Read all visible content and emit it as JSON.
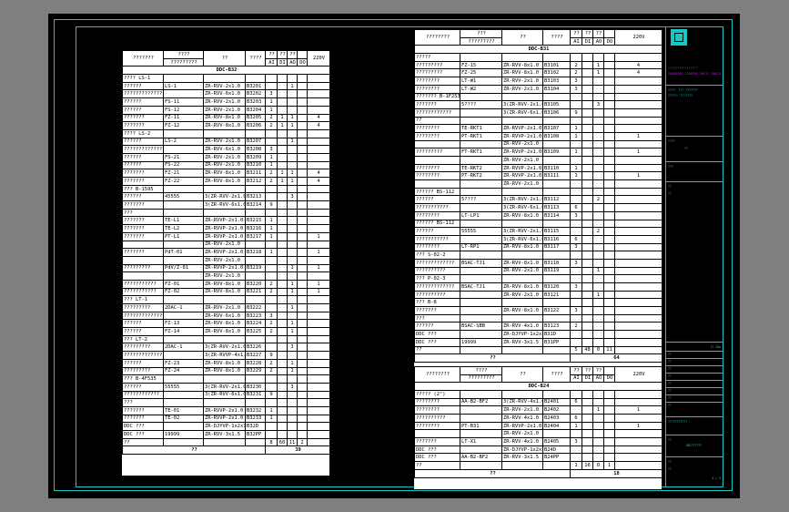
{
  "left_table": {
    "header": {
      "col1": "???????",
      "col2": "????",
      "col2b": "?????????",
      "col3": "??",
      "col4": "????",
      "m1": "??",
      "m2": "??",
      "m3": "??",
      "ai": "AI",
      "di": "DI",
      "ao": "AO",
      "do": "DO",
      "v24": "24V",
      "v220": "220V"
    },
    "title": "DDC-B32",
    "rows": [
      [
        "???? LS-1",
        "",
        "",
        "",
        "",
        "",
        "",
        "",
        ""
      ],
      [
        "??????",
        "LS-1",
        "ZR-RVV-2x1.0",
        "B3201",
        "",
        "",
        "1",
        "",
        ""
      ],
      [
        "?????????????",
        "",
        "ZR-RVV-6x1.0",
        "B3202",
        "3",
        "",
        "",
        "",
        ""
      ],
      [
        "??????",
        "FS-11",
        "ZR-RVV-2x1.0",
        "B3203",
        "1",
        "",
        "",
        "",
        ""
      ],
      [
        "??????",
        "FS-12",
        "ZR-RVV-2x1.0",
        "B3204",
        "1",
        "",
        "",
        "",
        ""
      ],
      [
        "???????",
        "FZ-11",
        "ZR-RVV-8x1.0",
        "B3205",
        "2",
        "1",
        "1",
        "",
        "4"
      ],
      [
        "???????",
        "FZ-12",
        "ZR-RVV-8x1.0",
        "B3206",
        "2",
        "1",
        "1",
        "",
        "4"
      ],
      [
        "???? LS-2",
        "",
        "",
        "",
        "",
        "",
        "",
        "",
        ""
      ],
      [
        "??????",
        "LS-2",
        "ZR-RVV-2x1.0",
        "B3207",
        "",
        "",
        "1",
        "",
        ""
      ],
      [
        "?????????????",
        "",
        "ZR-RVV-6x1.0",
        "B3208",
        "3",
        "",
        "",
        "",
        ""
      ],
      [
        "??????",
        "FS-21",
        "ZR-RVV-2x1.0",
        "B3209",
        "1",
        "",
        "",
        "",
        ""
      ],
      [
        "??????",
        "FS-22",
        "ZR-RVV-2x1.0",
        "B3210",
        "1",
        "",
        "",
        "",
        ""
      ],
      [
        "???????",
        "FZ-21",
        "ZR-RVV-8x1.0",
        "B3211",
        "2",
        "1",
        "1",
        "",
        "4"
      ],
      [
        "???????",
        "FZ-22",
        "ZR-RVV-8x1.0",
        "B3212",
        "2",
        "1",
        "1",
        "",
        "4"
      ],
      [
        "??? B-1595",
        "",
        "",
        "",
        "",
        "",
        "",
        "",
        ""
      ],
      [
        "??????",
        "45555",
        "3(ZR-RVV-2x1.0)",
        "B3213",
        "",
        "",
        "3",
        "",
        ""
      ],
      [
        "???????",
        "",
        "3(ZR-RVV-6x1.0)",
        "B3214",
        "9",
        "",
        "",
        "",
        ""
      ],
      [
        "???",
        "",
        "",
        "",
        "",
        "",
        "",
        "",
        ""
      ],
      [
        "???????",
        "TE-L1",
        "ZR-RVVP-2x1.0",
        "B3215",
        "1",
        "",
        "",
        "",
        ""
      ],
      [
        "???????",
        "TE-L2",
        "ZR-RVVP-2x1.0",
        "B3216",
        "1",
        "",
        "",
        "",
        ""
      ],
      [
        "???????",
        "PT-L1",
        "ZR-RVVP-2x1.0",
        "B3217",
        "1",
        "",
        "",
        "",
        "1"
      ],
      [
        "",
        "",
        "ZR-RVV-2x1.0",
        "",
        "",
        "",
        "",
        "",
        ""
      ],
      [
        "???????",
        "PdT-01",
        "ZR-RVVP-2x1.0",
        "B3218",
        "1",
        "",
        "",
        "",
        "1"
      ],
      [
        "",
        "",
        "ZR-RVV-2x1.0",
        "",
        "",
        "",
        "",
        "",
        ""
      ],
      [
        "?????????",
        "PdV/Z-01",
        "ZR-RVVP-2x1.0",
        "B3219",
        "",
        "",
        "1",
        "",
        "1"
      ],
      [
        "",
        "",
        "ZR-RVV-2x1.0",
        "",
        "",
        "",
        "",
        "",
        ""
      ],
      [
        "???????????",
        "FZ-01",
        "ZR-RVV-8x1.0",
        "B3220",
        "2",
        "",
        "1",
        "",
        "1"
      ],
      [
        "???????????",
        "FZ-02",
        "ZR-RVV-8x1.0",
        "B3221",
        "2",
        "",
        "1",
        "",
        "1"
      ],
      [
        "??? LT-1",
        "",
        "",
        "",
        "",
        "",
        "",
        "",
        ""
      ],
      [
        "?????????",
        "2DAC-1",
        "ZR-RVV-2x1.0",
        "B3222",
        "",
        "",
        "1",
        "",
        ""
      ],
      [
        "????????????????",
        "",
        "ZR-RVV-6x1.0",
        "B3223",
        "3",
        "",
        "",
        "",
        ""
      ],
      [
        "??????",
        "FZ-13",
        "ZR-RVV-8x1.0",
        "B3224",
        "2",
        "",
        "1",
        "",
        ""
      ],
      [
        "??????",
        "FZ-14",
        "ZR-RVV-8x1.0",
        "B3225",
        "2",
        "",
        "1",
        "",
        ""
      ],
      [
        "??? LT-2",
        "",
        "",
        "",
        "",
        "",
        "",
        "",
        ""
      ],
      [
        "?????????",
        "2DAC-1",
        "3(ZR-RVV-2x1.0)",
        "B3226",
        "",
        "",
        "3",
        "",
        ""
      ],
      [
        "????????????????",
        "",
        "3(ZR-RVVP-4x1.0)",
        "B3227",
        "9",
        "",
        "",
        "",
        ""
      ],
      [
        "??????",
        "FZ-23",
        "ZR-RVV-8x1.0",
        "B3228",
        "2",
        "",
        "1",
        "",
        ""
      ],
      [
        "?????????",
        "FZ-24",
        "ZR-RVV-8x1.0",
        "B3229",
        "2",
        "",
        "1",
        "",
        ""
      ],
      [
        "??? B-4F535",
        "",
        "",
        "",
        "",
        "",
        "",
        "",
        ""
      ],
      [
        "??????",
        "55555",
        "3(ZR-RVV-2x1.0)",
        "B3230",
        "",
        "",
        "3",
        "",
        ""
      ],
      [
        "????????????",
        "",
        "3(ZR-RVV-6x1.0)",
        "B3231",
        "9",
        "",
        "",
        "",
        ""
      ],
      [
        "???",
        "",
        "",
        "",
        "",
        "",
        "",
        "",
        ""
      ],
      [
        "???????",
        "TE-01",
        "ZR-RVVP-2x1.0",
        "B3232",
        "1",
        "",
        "",
        "",
        ""
      ],
      [
        "???????",
        "TE-02",
        "ZR-RVVP-2x1.0",
        "B3233",
        "1",
        "",
        "",
        "",
        ""
      ],
      [
        "DDC ???",
        "",
        "ZR-DJYVP-1x2x1.0",
        "B32D",
        "",
        "",
        "",
        "",
        ""
      ],
      [
        "DDC ???",
        "19999",
        "ZR-RVV-3x1.5",
        "B32PP",
        "",
        "",
        "",
        "",
        ""
      ],
      [
        "??",
        "",
        "",
        "",
        "8",
        "60",
        "11",
        "2",
        ""
      ]
    ],
    "total_label": "??",
    "total_value": "39"
  },
  "right_table_top": {
    "header": {
      "col1": "????????",
      "col2": "???",
      "col2b": "?????????",
      "col3": "??",
      "col4": "????",
      "m1": "??",
      "m2": "??",
      "m3": "??",
      "ai": "AI",
      "di": "DI",
      "ao": "AO",
      "do": "DO",
      "v24": "24V",
      "v220": "220V"
    },
    "title": "DDC-B31",
    "rows": [
      [
        "?????",
        "",
        "",
        "",
        "",
        "",
        "",
        "",
        ""
      ],
      [
        "?????????",
        "FZ-15",
        "ZR-RVV-8x1.0",
        "B3101",
        "2",
        "",
        "1",
        "",
        "4"
      ],
      [
        "?????????",
        "FZ-25",
        "ZR-RVV-8x1.0",
        "B3102",
        "2",
        "",
        "1",
        "",
        "4"
      ],
      [
        "????????",
        "LT-W1",
        "ZR-RVV-2x1.0",
        "B3103",
        "3",
        "",
        "",
        "",
        ""
      ],
      [
        "????????",
        "LT-W2",
        "ZR-RVV-2x1.0",
        "B3104",
        "3",
        "",
        "",
        "",
        ""
      ],
      [
        "??????? B-1F253",
        "",
        "",
        "",
        "",
        "",
        "",
        "",
        ""
      ],
      [
        "???????",
        "5????",
        "3(ZR-RVV-2x1.0)",
        "B3105",
        "",
        "",
        "3",
        "",
        ""
      ],
      [
        "????????????",
        "",
        "3(ZR-RVV-6x1.0)",
        "B3106",
        "9",
        "",
        "",
        "",
        ""
      ],
      [
        "??",
        "",
        "",
        "",
        "",
        "",
        "",
        "",
        ""
      ],
      [
        "????????",
        "TE-RKT1",
        "ZR-RVVP-2x1.0",
        "B3107",
        "1",
        "",
        "",
        "",
        ""
      ],
      [
        "????????",
        "PT-RKT1",
        "ZR-RVVP-2x1.0",
        "B3108",
        "1",
        "",
        "",
        "",
        "1"
      ],
      [
        "",
        "",
        "ZR-RVV-2x1.0",
        "",
        "",
        "",
        "",
        "",
        ""
      ],
      [
        "?????????",
        "FT-RKT1",
        "ZR-RVVP-2x1.0",
        "B3109",
        "1",
        "",
        "",
        "",
        "1"
      ],
      [
        "",
        "",
        "ZR-RVV-2x1.0",
        "",
        "",
        "",
        "",
        "",
        ""
      ],
      [
        "????????",
        "TE-RKT2",
        "ZR-RVVP-2x1.0",
        "B3110",
        "1",
        "",
        "",
        "",
        ""
      ],
      [
        "????????",
        "PT-RKT2",
        "ZR-RVVP-2x1.0",
        "B3111",
        "1",
        "",
        "",
        "",
        "1"
      ],
      [
        "",
        "",
        "ZR-RVV-2x1.0",
        "",
        "",
        "",
        "",
        "",
        ""
      ],
      [
        "?????? BS-112",
        "",
        "",
        "",
        "",
        "",
        "",
        "",
        ""
      ],
      [
        "??????",
        "5????",
        "3(ZR-RVV-2x1.0)",
        "B3112",
        "",
        "",
        "2",
        "",
        ""
      ],
      [
        "???????????",
        "",
        "3(ZR-RVV-6x1.0)",
        "B3113",
        "6",
        "",
        "",
        "",
        ""
      ],
      [
        "????????",
        "LT-LP1",
        "ZR-RVV-8x1.0",
        "B3114",
        "3",
        "",
        "",
        "",
        ""
      ],
      [
        "?????? BS-112",
        "",
        "",
        "",
        "",
        "",
        "",
        "",
        ""
      ],
      [
        "??????",
        "55555",
        "3(ZR-RVV-2x1.0)",
        "B3115",
        "",
        "",
        "2",
        "",
        ""
      ],
      [
        "???????????",
        "",
        "3(ZR-RVV-6x1.0)",
        "B3116",
        "6",
        "",
        "",
        "",
        ""
      ],
      [
        "????????",
        "LT-RP1",
        "ZR-RVV-8x1.0",
        "B3117",
        "3",
        "",
        "",
        "",
        ""
      ],
      [
        "??? S-02-2",
        "",
        "",
        "",
        "",
        "",
        "",
        "",
        ""
      ],
      [
        "?????????????",
        "BSAC-TJ1",
        "ZR-RVV-8x1.0",
        "B3118",
        "3",
        "",
        "",
        "",
        ""
      ],
      [
        "??????????",
        "",
        "ZR-RVV-2x1.0",
        "B3119",
        "",
        "",
        "1",
        "",
        ""
      ],
      [
        "??? P-02-3",
        "",
        "",
        "",
        "",
        "",
        "",
        "",
        ""
      ],
      [
        "?????????????",
        "BSAC-TJ1",
        "ZR-RVV-8x1.0",
        "B3120",
        "3",
        "",
        "",
        "",
        ""
      ],
      [
        "??????????",
        "",
        "ZR-RVV-2x1.0",
        "B3121",
        "",
        "",
        "1",
        "",
        ""
      ],
      [
        "??? B-8",
        "",
        "",
        "",
        "",
        "",
        "",
        "",
        ""
      ],
      [
        "???????",
        "",
        "ZR-RVV-8x1.0",
        "B3122",
        "3",
        "",
        "",
        "",
        ""
      ],
      [
        "???",
        "",
        "",
        "",
        "",
        "",
        "",
        "",
        ""
      ],
      [
        "??????",
        "BSAC-SBB",
        "ZR-RVV-4x1.0",
        "B3123",
        "2",
        "",
        "",
        "",
        ""
      ],
      [
        "DDC ???",
        "",
        "ZR-DJYVP-1x2x1.0",
        "B31D",
        "",
        "",
        "",
        "",
        ""
      ],
      [
        "DDC ???",
        "19999",
        "ZR-RVV-3x1.5",
        "B31PP",
        "",
        "",
        "",
        "",
        ""
      ],
      [
        "??",
        "",
        "",
        "",
        "5",
        "48",
        "0",
        "11",
        ""
      ]
    ],
    "total_label": "??",
    "total_value": "64"
  },
  "right_table_bottom": {
    "header": {
      "col1": "????????",
      "col2": "????",
      "col2b": "?????????",
      "col3": "??",
      "col4": "????",
      "m1": "??",
      "m2": "??",
      "m3": "??",
      "ai": "AI",
      "di": "DI",
      "ao": "AO",
      "do": "DO",
      "v24": "24V",
      "v220": "220V"
    },
    "title": "DDC-B24",
    "rows": [
      [
        "????? (2\")",
        "",
        "",
        "",
        "",
        "",
        "",
        "",
        ""
      ],
      [
        "????????",
        "AA-B2-BF2",
        "3(ZR-RVV-4x1.0)",
        "B2401",
        "6",
        "",
        "",
        "",
        ""
      ],
      [
        "????????",
        "",
        "ZR-RVV-2x1.0",
        "B2402",
        "",
        "",
        "1",
        "",
        "1"
      ],
      [
        "??????????",
        "",
        "ZR-RVV-4x1.0",
        "B2403",
        "6",
        "",
        "",
        "",
        ""
      ],
      [
        "????????",
        "PT-B31",
        "ZR-RVVP-2x1.0",
        "B2404",
        "1",
        "",
        "",
        "",
        "1"
      ],
      [
        "",
        "",
        "ZR-RVV-2x1.0",
        "",
        "",
        "",
        "",
        "",
        ""
      ],
      [
        "???????",
        "LT-X1",
        "ZR-RVV-4x1.0",
        "B2405",
        "3",
        "",
        "",
        "",
        ""
      ],
      [
        "DDC ???",
        "",
        "ZR-DJYVP-1x2x1.0",
        "B24D",
        "",
        "",
        "",
        "",
        ""
      ],
      [
        "DDC ???",
        "AA-B2-BF2",
        "ZR-RVV-3x1.5",
        "B24PP",
        "",
        "",
        "",
        "",
        ""
      ],
      [
        "??",
        "",
        "",
        "",
        "1",
        "16",
        "0",
        "1",
        ""
      ]
    ],
    "total_label": "??",
    "total_value": "18"
  },
  "title_block": {
    "org_name": "????????????????",
    "org_name_en": "ZHONGGUO JIANZHU SHEJI YANJIUYUAN",
    "cert_lines": [
      "????: ???-???????",
      "?????: ???????"
    ],
    "field_labels": [
      "????",
      "??",
      "???",
      "??",
      "??",
      "??",
      "??",
      "??",
      "??",
      "??",
      "??",
      "??",
      "??"
    ],
    "drawing_title": "???????????",
    "drawing_no": "??",
    "scale_label": "??",
    "date_label": "??",
    "sheet_label": "DDC??????",
    "page": "4 / 5",
    "stamp": "17.18b"
  },
  "colors": {
    "frame": "#18c6c6",
    "background": "#000000",
    "surround": "#7f7f7f",
    "paper": "#ffffff",
    "org": "#cc00ff"
  }
}
